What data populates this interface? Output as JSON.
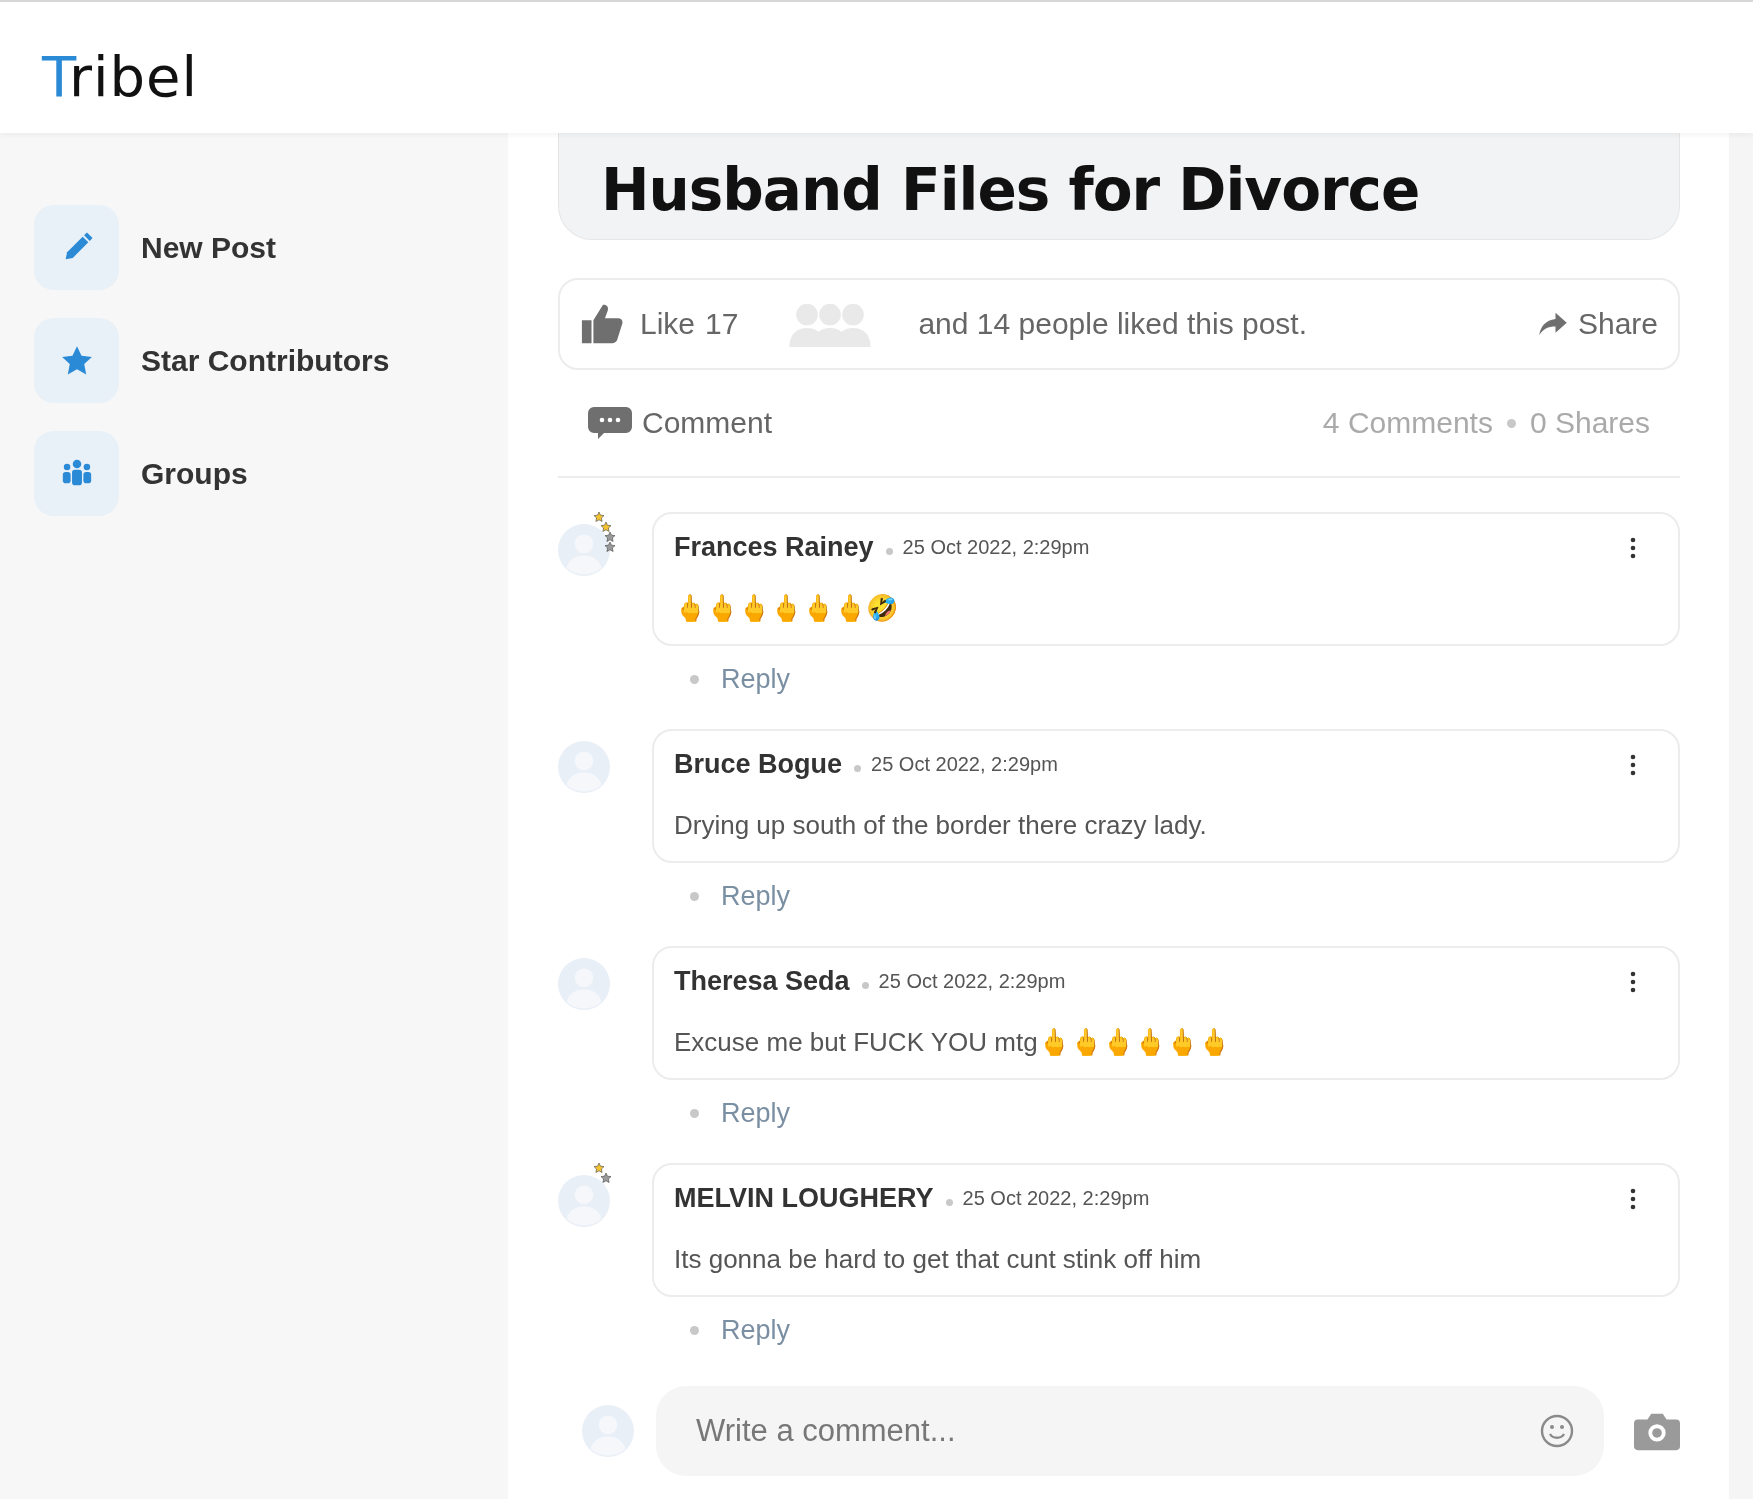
{
  "header": {
    "logo": "Tribel"
  },
  "sidebar": {
    "items": [
      {
        "label": "New Post"
      },
      {
        "label": "Star Contributors"
      },
      {
        "label": "Groups"
      }
    ]
  },
  "post": {
    "headline": [
      "Husband Files for Divorce"
    ],
    "like_bar": {
      "like": "Like",
      "like_count": "17",
      "liked_text": "and 14 people liked this post.",
      "share": "Share"
    },
    "actions": {
      "comment": "Comment",
      "comments_count": "4 Comments",
      "shares_count": "0 Shares"
    },
    "comments": [
      {
        "name": "Frances Rainey",
        "time": "25 Oct 2022, 2:29pm",
        "text": "🖕🖕🖕🖕🖕🖕🤣",
        "badges": [
          {
            "color": "#f2c230"
          },
          {
            "color": "#f2c230"
          },
          {
            "color": "#9a9a9a"
          },
          {
            "color": "#9a9a9a"
          }
        ],
        "reply": "Reply"
      },
      {
        "name": "Bruce Bogue",
        "time": "25 Oct 2022, 2:29pm",
        "text": "Drying up south of the border there crazy lady.",
        "reply": "Reply"
      },
      {
        "name": "Theresa Seda",
        "time": "25 Oct 2022, 2:29pm",
        "text": "Excuse me but FUCK YOU mtg🖕🖕🖕🖕🖕🖕",
        "reply": "Reply"
      },
      {
        "name": "MELVIN LOUGHERY",
        "time": "25 Oct 2022, 2:29pm",
        "text": "Its gonna be hard to get that cunt stink off him",
        "badges": [
          {
            "color": "#f2c230"
          },
          {
            "color": "#9a9a9a"
          }
        ],
        "reply": "Reply"
      }
    ],
    "composer": {
      "placeholder": "Write a comment..."
    }
  }
}
